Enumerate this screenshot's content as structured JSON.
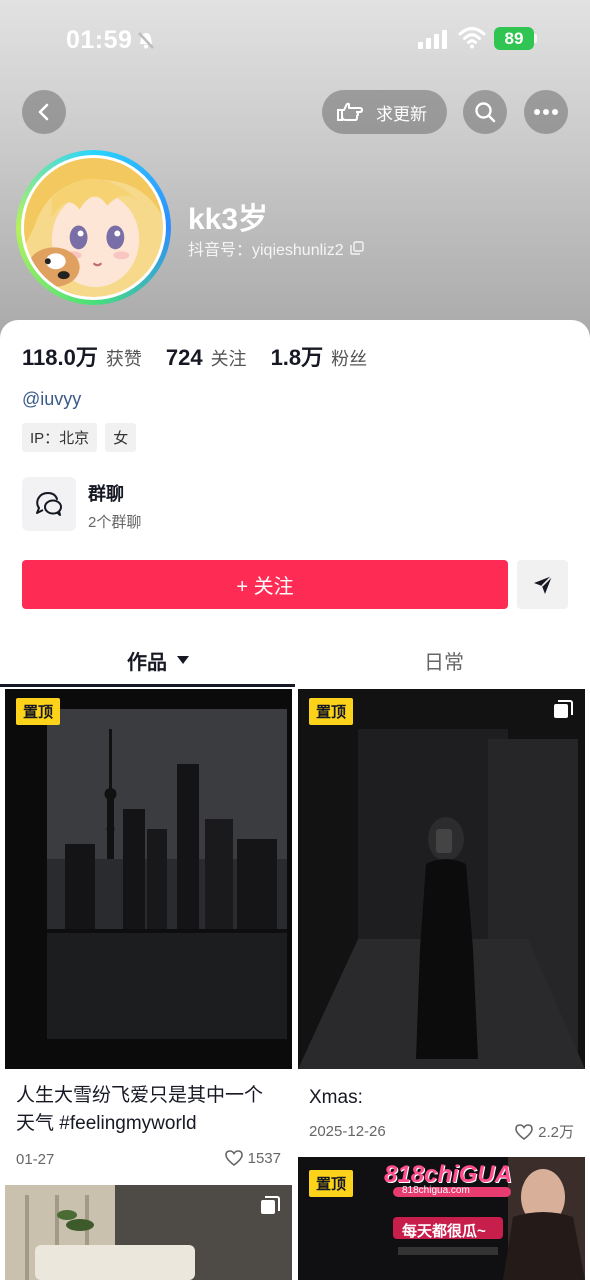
{
  "status_bar": {
    "time": "01:59",
    "battery": "89"
  },
  "header": {
    "request_update_label": "求更新"
  },
  "profile": {
    "nickname": "kk3岁",
    "douyin_id": "抖音号：yiqieshunliz2",
    "stats": [
      {
        "value": "118.0万",
        "label": "获赞"
      },
      {
        "value": "724",
        "label": "关注"
      },
      {
        "value": "1.8万",
        "label": "粉丝"
      }
    ],
    "handle": "@iuvyy",
    "tags": [
      "IP：北京",
      "女"
    ]
  },
  "group_chat": {
    "title": "群聊",
    "subtitle": "2个群聊"
  },
  "actions": {
    "follow_label": "+ 关注"
  },
  "tabs": [
    {
      "label": "作品"
    },
    {
      "label": "日常"
    }
  ],
  "posts": [
    {
      "badge": "置顶",
      "title": "人生大雪纷飞爱只是其中一个天气 #feelingmyworld",
      "date": "01-27",
      "likes": "1537"
    },
    {
      "badge": "置顶",
      "title": "Xmas:",
      "date": "2025-12-26",
      "likes": "2.2万"
    },
    {
      "badge": "",
      "title": "",
      "date": "",
      "likes": ""
    },
    {
      "badge": "置顶",
      "title": "",
      "date": "",
      "likes": "",
      "ad_text": "818chiGUA",
      "ad_site": "818chigua.com",
      "ad_slogan": "每天都很瓜~"
    }
  ],
  "colors": {
    "accent": "#fe2c55",
    "pin_badge": "#fcd21b",
    "handle_link": "#3a5a8c"
  }
}
